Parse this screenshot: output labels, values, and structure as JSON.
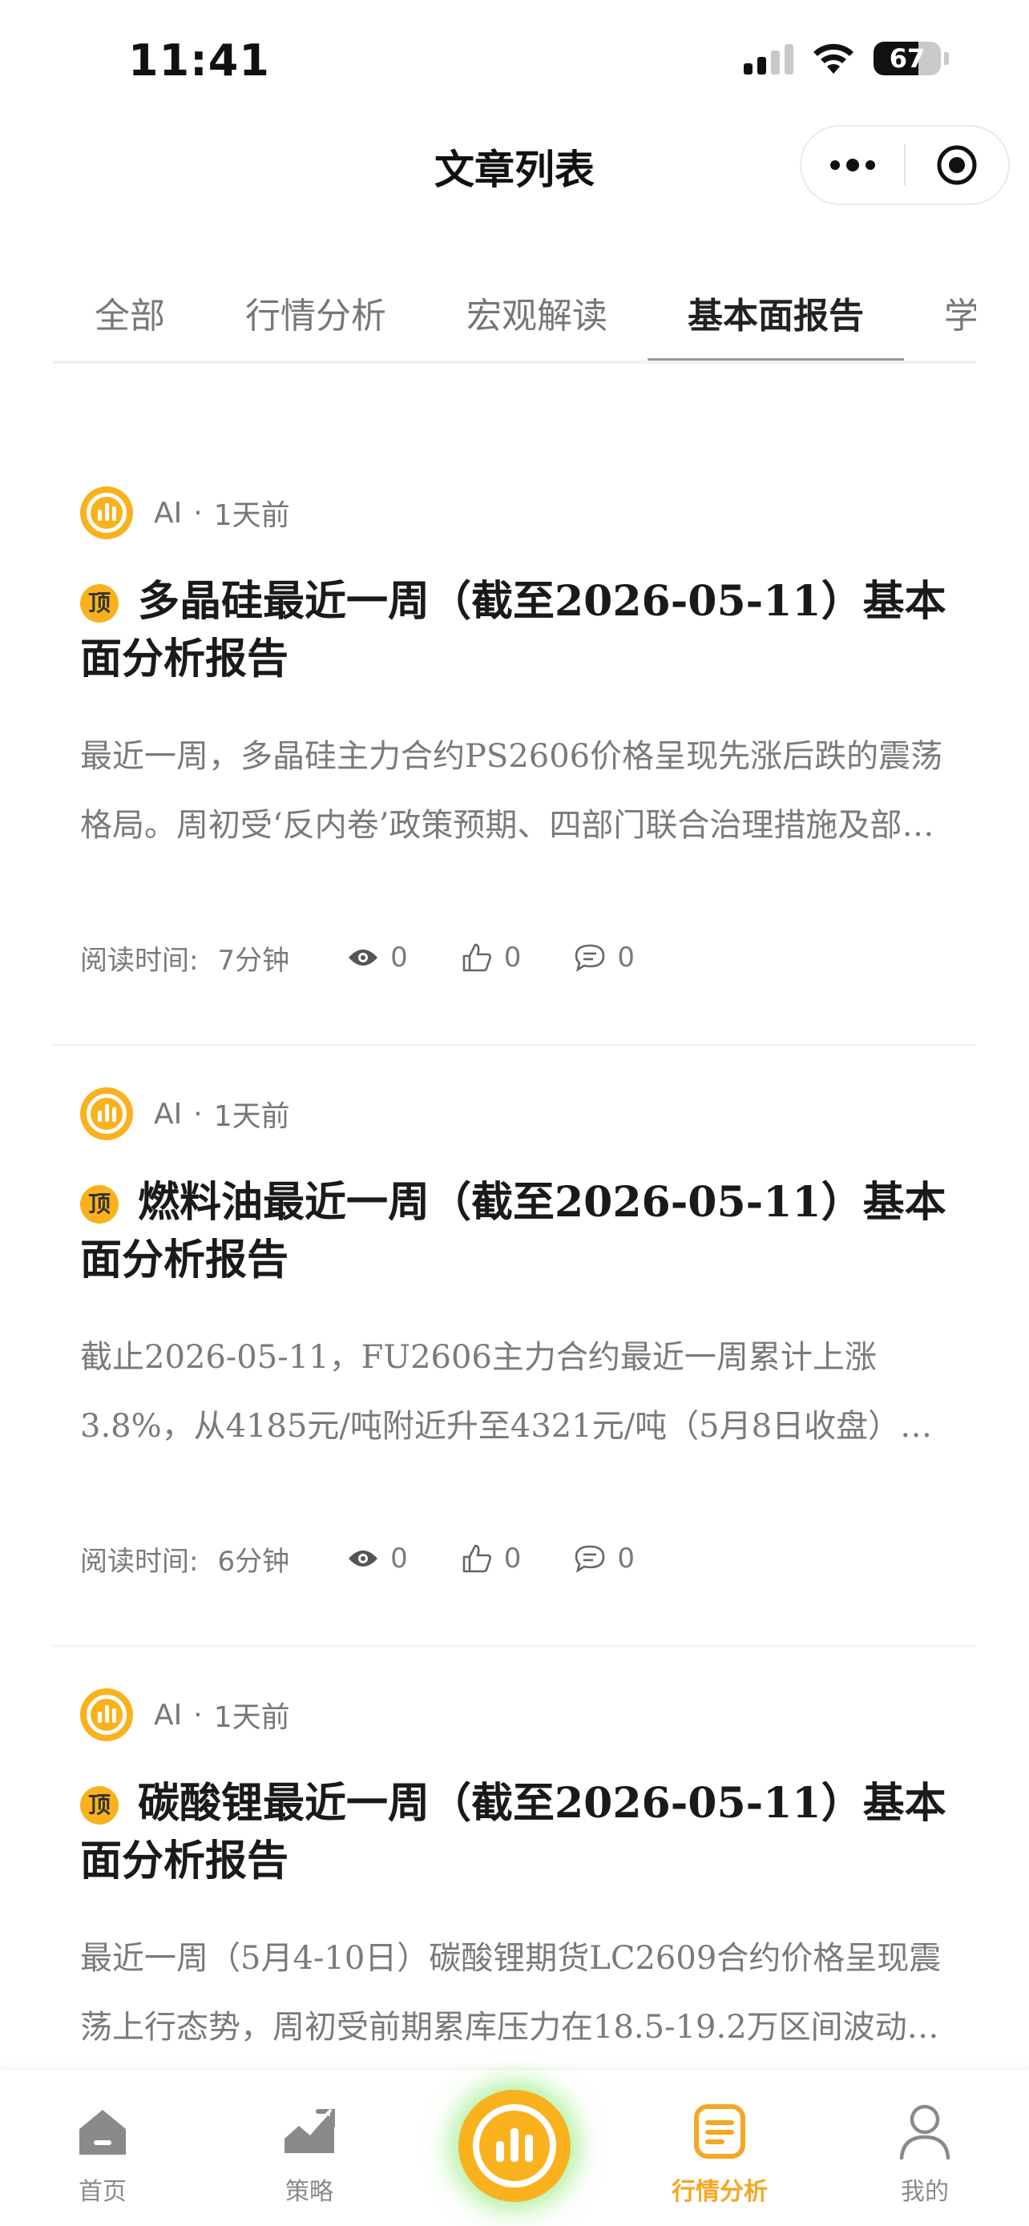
{
  "status": {
    "time": "11:41",
    "battery": "67",
    "battery_level": 0.67
  },
  "nav": {
    "title": "文章列表"
  },
  "tabs": [
    {
      "label": "全部"
    },
    {
      "label": "行情分析"
    },
    {
      "label": "宏观解读"
    },
    {
      "label": "基本面报告",
      "active": true
    },
    {
      "label": "学"
    }
  ],
  "articles": [
    {
      "author": "AI",
      "dot": "·",
      "time": "1天前",
      "badge": "顶",
      "title": "多晶硅最近一周（截至2026-05-11）基本面分析报告",
      "summary1": "最近一周，多晶硅主力合约PS2606价格呈现先涨后跌的震荡",
      "summary2": "格局。周初受‘反内卷’政策预期、四部门联合治理措施及部门…",
      "read_label": "阅读时间:",
      "read_time": "7分钟",
      "views": "0",
      "likes": "0",
      "comments": "0"
    },
    {
      "author": "AI",
      "dot": "·",
      "time": "1天前",
      "badge": "顶",
      "title": "燃料油最近一周（截至2026-05-11）基本面分析报告",
      "summary1": "截止2026-05-11，FU2606主力合约最近一周累计上涨",
      "summary2": "3.8%，从4185元/吨附近升至4321元/吨（5月8日收盘）…",
      "read_label": "阅读时间:",
      "read_time": "6分钟",
      "views": "0",
      "likes": "0",
      "comments": "0"
    },
    {
      "author": "AI",
      "dot": "·",
      "time": "1天前",
      "badge": "顶",
      "title": "碳酸锂最近一周（截至2026-05-11）基本面分析报告",
      "summary1": "最近一周（5月4-10日）碳酸锂期货LC2609合约价格呈现震",
      "summary2": "荡上行态势，周初受前期累库压力在18.5-19.2万区间波动…",
      "read_label": "阅读时间:",
      "read_time": "6分钟",
      "views": "0",
      "likes": "0",
      "comments": "0"
    }
  ],
  "tabbar": {
    "home": "首页",
    "strategy": "策略",
    "market": "行情分析",
    "mine": "我的"
  },
  "colors": {
    "accent": "#f9b21d",
    "active_tab": "#f5a623",
    "glow": "#78e65a"
  }
}
